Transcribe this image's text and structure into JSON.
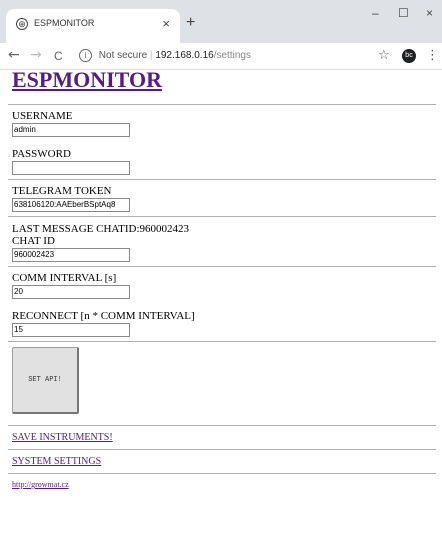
{
  "browser": {
    "tab_title": "ESPMONITOR",
    "tab_close": "×",
    "new_tab": "+",
    "window": {
      "minimize": "–",
      "maximize": "☐",
      "close": "×"
    },
    "back": "←",
    "forward": "→",
    "reload": "C",
    "security_label": "Not secure",
    "url_host": "192.168.0.16",
    "url_path": "/settings",
    "star": "☆",
    "profile_initials": "bc",
    "menu": "⋮"
  },
  "header": {
    "title": "ESPMONITOR"
  },
  "form": {
    "username": {
      "label": "USERNAME",
      "value": "admin"
    },
    "password": {
      "label": "PASSWORD",
      "value": ""
    },
    "telegram_token": {
      "label": "TELEGRAM TOKEN",
      "value": "638106120:AAEberBSptAq8"
    },
    "last_message": {
      "label": "LAST MESSAGE CHATID:",
      "value": "960002423"
    },
    "chat_id": {
      "label": "CHAT ID",
      "value": "960002423"
    },
    "comm_interval": {
      "label": "COMM INTERVAL [s]",
      "value": "20"
    },
    "reconnect": {
      "label": "RECONNECT [n * COMM INTERVAL]",
      "value": "15"
    },
    "set_api_button": "SET API!"
  },
  "links": {
    "save_instruments": "SAVE INSTRUMENTS!",
    "system_settings": "SYSTEM SETTINGS",
    "footer_url": "http://growmat.cz"
  }
}
